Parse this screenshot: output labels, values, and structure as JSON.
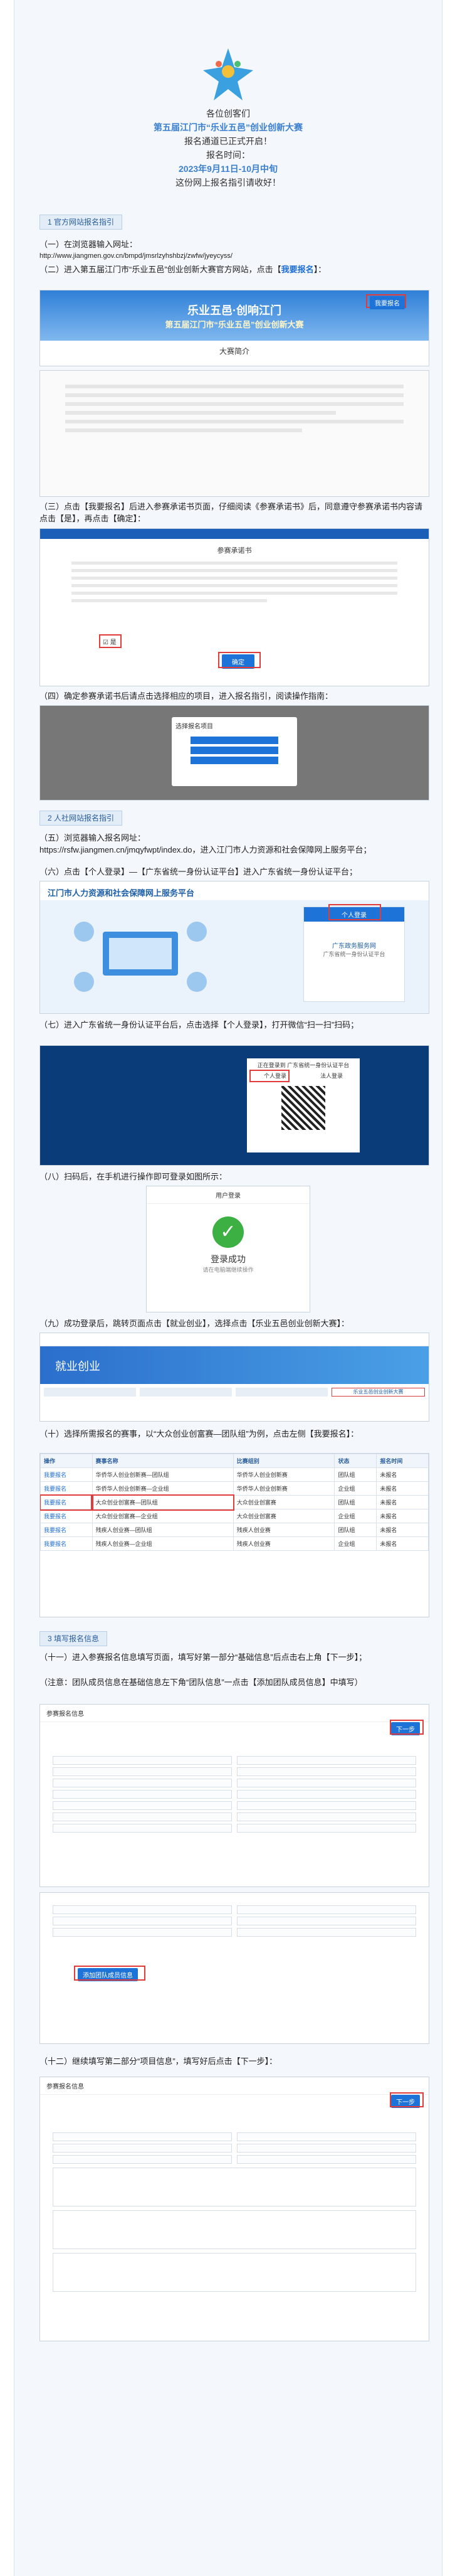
{
  "intro": {
    "greeting": "各位创客们",
    "title": "第五届江门市“乐业五邑”创业创新大赛",
    "open_text": "报名通道已正式开启！",
    "time_label": "报名时间：",
    "time_value": "2023年9月11日-10月中旬",
    "guide_text": "这份网上报名指引请收好！"
  },
  "sections": {
    "s1": "1 官方网站报名指引",
    "s2": "2 人社网站报名指引",
    "s3": "3 填写报名信息"
  },
  "steps": {
    "step1": "（一）在浏览器输入网址：",
    "url1": "http://www.jiangmen.gov.cn/bmpd/jmsrlzyhshbzj/zwfw/jyeycyss/",
    "step2a": "（二）进入第五届江门市“乐业五邑”创业创新大赛官方网站，点击【",
    "step2b": "我要报名",
    "step2c": "】：",
    "step3": "（三）点击【我要报名】后进入参赛承诺书页面，仔细阅读《参赛承诺书》后，同意遵守参赛承诺书内容请点击【是】，再点击【确定】：",
    "step4": "（四）确定参赛承诺书后请点击选择相应的项目，进入报名指引，阅读操作指南：",
    "s2_step1": "（五）浏览器输入报名网址：",
    "url2": "https://rsfw.jiangmen.cn/jmqyfwpt/index.do，进入江门市人力资源和社会保障网上服务平台；",
    "s2_step2": "（六）点击【个人登录】—【广东省统一身份认证平台】进入广东省统一身份认证平台；",
    "s2_step3": "（七）进入广东省统一身份认证平台后，点击选择【个人登录】，打开微信“扫一扫”扫码；",
    "s2_step4": "（八）扫码后，在手机进行操作即可登录如图所示：",
    "s2_step5": "（九）成功登录后，跳转页面点击【就业创业】，选择点击【乐业五邑创业创新大赛】：",
    "s2_step6": "（十）选择所需报名的赛事，以“大众创业创富赛—团队组”为例，点击左侧【我要报名】：",
    "s3_step1": "（十一）进入参赛报名信息填写页面，填写好第一部分“基础信息”后点击右上角【下一步】；",
    "s3_note": "（注意：团队成员信息在基础信息左下角“团队信息”一点击【添加团队成员信息】中填写）",
    "s3_step2": "（十二）继续填写第二部分“项目信息”，填写好后点击【下一步】："
  },
  "shots": {
    "site_title": "乐业五邑·创响江门",
    "site_subtitle": "第五届江门市“乐业五邑”创业创新大赛",
    "intro_heading": "大赛简介",
    "register_btn": "我要报名",
    "promise_title": "参赛承诺书",
    "confirm_btn": "确定",
    "yes_label": "是",
    "popup_title": "选择报名项目",
    "platform_title": "江门市人力资源和社会保障网上服务平台",
    "personal_login": "个人登录",
    "gd_platform": "广东政务服务网",
    "gd_login_title": "广东省统一身份认证平台",
    "qr_title": "正在登录到 广东省统一身份认证平台",
    "qr_personal": "个人登录",
    "qr_corp": "法人登录",
    "success_header": "用户登录",
    "success_text": "登录成功",
    "success_sub": "请在电脑端继续操作",
    "jobs_banner": "就业创业",
    "contest_tab": "乐业五邑创业创新大赛",
    "table_headers": [
      "操作",
      "赛事名称",
      "比赛组别",
      "状态",
      "报名时间"
    ],
    "table_rows": [
      [
        "我要报名",
        "华侨华人创业创新赛—团队组",
        "华侨华人创业创新赛",
        "团队组",
        "未报名"
      ],
      [
        "我要报名",
        "华侨华人创业创新赛—企业组",
        "华侨华人创业创新赛",
        "企业组",
        "未报名"
      ],
      [
        "我要报名",
        "大众创业创富赛—团队组",
        "大众创业创富赛",
        "团队组",
        "未报名"
      ],
      [
        "我要报名",
        "大众创业创富赛—企业组",
        "大众创业创富赛",
        "企业组",
        "未报名"
      ],
      [
        "我要报名",
        "残疾人创业赛—团队组",
        "残疾人创业赛",
        "团队组",
        "未报名"
      ],
      [
        "我要报名",
        "残疾人创业赛—企业组",
        "残疾人创业赛",
        "企业组",
        "未报名"
      ]
    ],
    "form_title": "参赛报名信息",
    "next_btn": "下一步",
    "add_member_btn": "添加团队成员信息"
  }
}
